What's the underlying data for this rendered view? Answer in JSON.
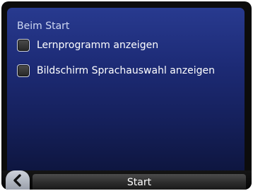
{
  "section": {
    "title": "Beim Start"
  },
  "options": [
    {
      "label": "Lernprogramm anzeigen",
      "checked": false
    },
    {
      "label": "Bildschirm Sprachauswahl anzeigen",
      "checked": false
    }
  ],
  "footer": {
    "back_icon": "chevron-left-icon",
    "start_label": "Start"
  },
  "colors": {
    "screen_background": "#1d2b76",
    "frame": "#0c0c0c",
    "text": "#ffffff",
    "section_text": "#cfd8f2"
  }
}
